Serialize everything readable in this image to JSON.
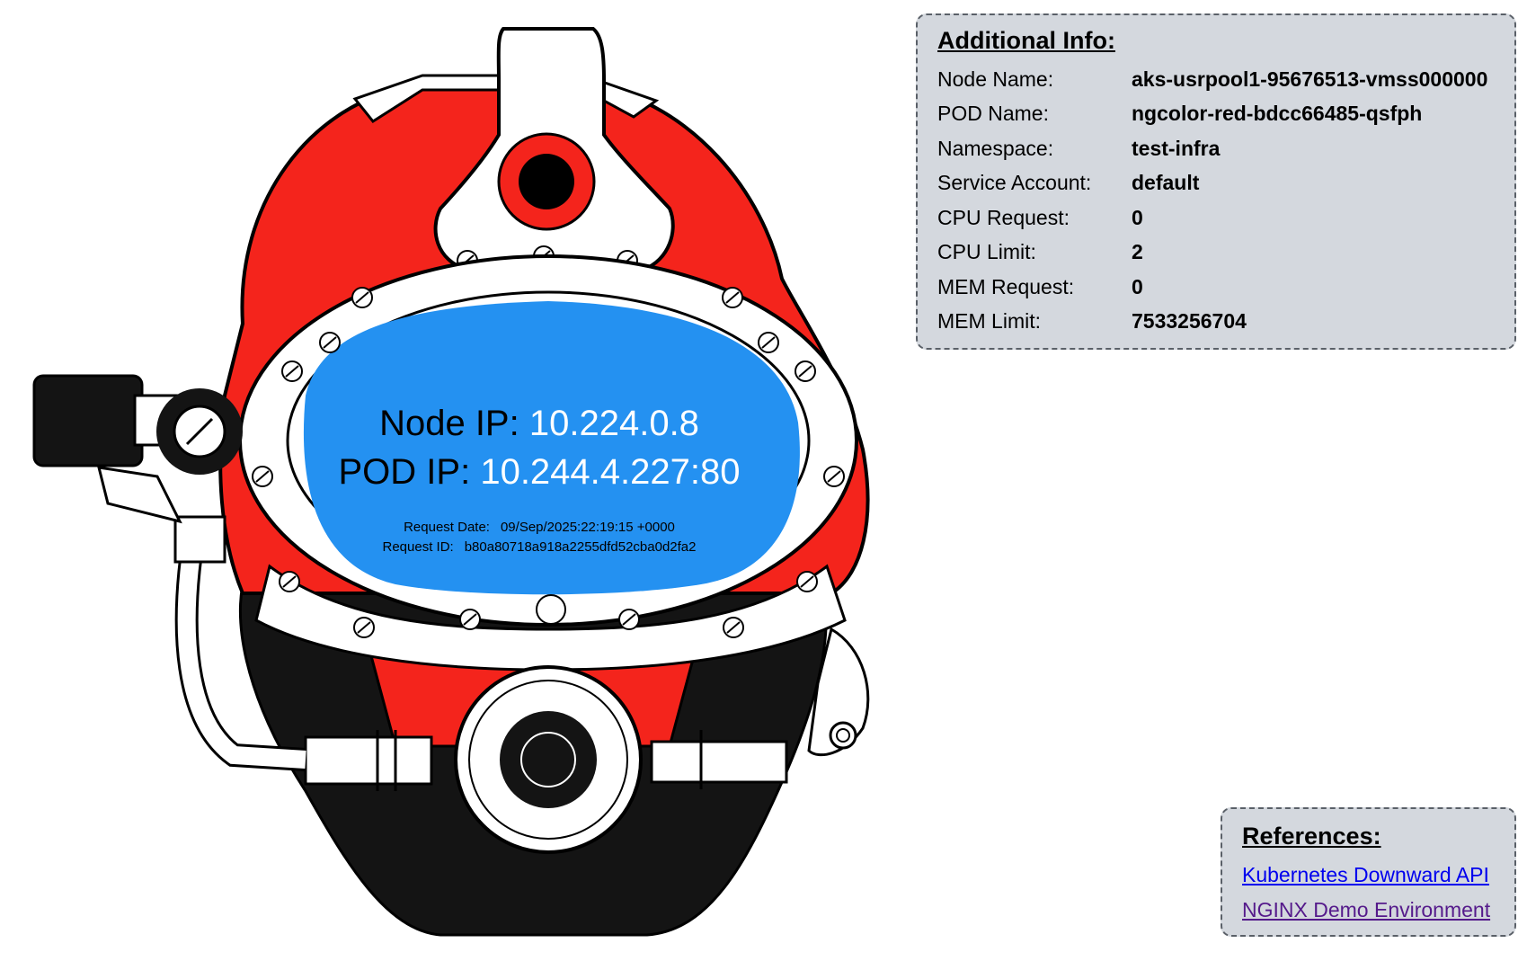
{
  "visor": {
    "node_ip_label": "Node IP:",
    "node_ip_value": "10.224.0.8",
    "pod_ip_label": "POD IP:",
    "pod_ip_value": "10.244.4.227:80",
    "request_date_label": "Request Date:",
    "request_date_value": "09/Sep/2025:22:19:15 +0000",
    "request_id_label": "Request ID:",
    "request_id_value": "b80a80718a918a2255dfd52cba0d2fa2"
  },
  "info": {
    "title": "Additional Info:",
    "rows": [
      {
        "label": "Node Name:",
        "value": "aks-usrpool1-95676513-vmss000000"
      },
      {
        "label": "POD Name:",
        "value": "ngcolor-red-bdcc66485-qsfph"
      },
      {
        "label": "Namespace:",
        "value": "test-infra"
      },
      {
        "label": "Service Account:",
        "value": "default"
      },
      {
        "label": "CPU Request:",
        "value": "0"
      },
      {
        "label": "CPU Limit:",
        "value": "2"
      },
      {
        "label": "MEM Request:",
        "value": "0"
      },
      {
        "label": "MEM Limit:",
        "value": "7533256704"
      }
    ]
  },
  "references": {
    "title": "References:",
    "links": [
      {
        "label": "Kubernetes Downward API"
      },
      {
        "label": "NGINX Demo Environment"
      }
    ]
  },
  "colors": {
    "helmet_shell": "#f4241c",
    "visor": "#2491f1",
    "panel_bg": "#d4d8de",
    "link": "#0000ee",
    "visited_link": "#551a8b"
  },
  "icons": {
    "illustration": "diving-helmet-illustration"
  }
}
